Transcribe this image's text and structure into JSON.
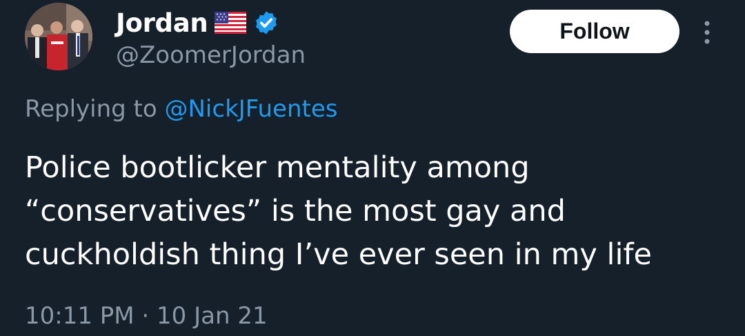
{
  "author": {
    "display_name": "Jordan",
    "handle": "@ZoomerJordan",
    "flag_icon": "us-flag-icon",
    "verified_icon": "verified-badge-icon",
    "verified_color": "#1d9bf0"
  },
  "follow_button": {
    "label": "Follow"
  },
  "more_menu": {
    "icon": "more-vertical-icon"
  },
  "reply": {
    "prefix": "Replying to",
    "target": "@NickJFuentes"
  },
  "tweet": {
    "lines": [
      "Police bootlicker mentality among",
      "“conservatives” is the most gay and",
      "cuckholdish thing I’ve ever seen in my life"
    ]
  },
  "meta": {
    "timestamp": "10:11 PM · 10 Jan 21"
  },
  "colors": {
    "background": "#15202b",
    "text_primary": "#ffffff",
    "text_secondary": "#8b98a5",
    "accent": "#1d9bf0"
  }
}
